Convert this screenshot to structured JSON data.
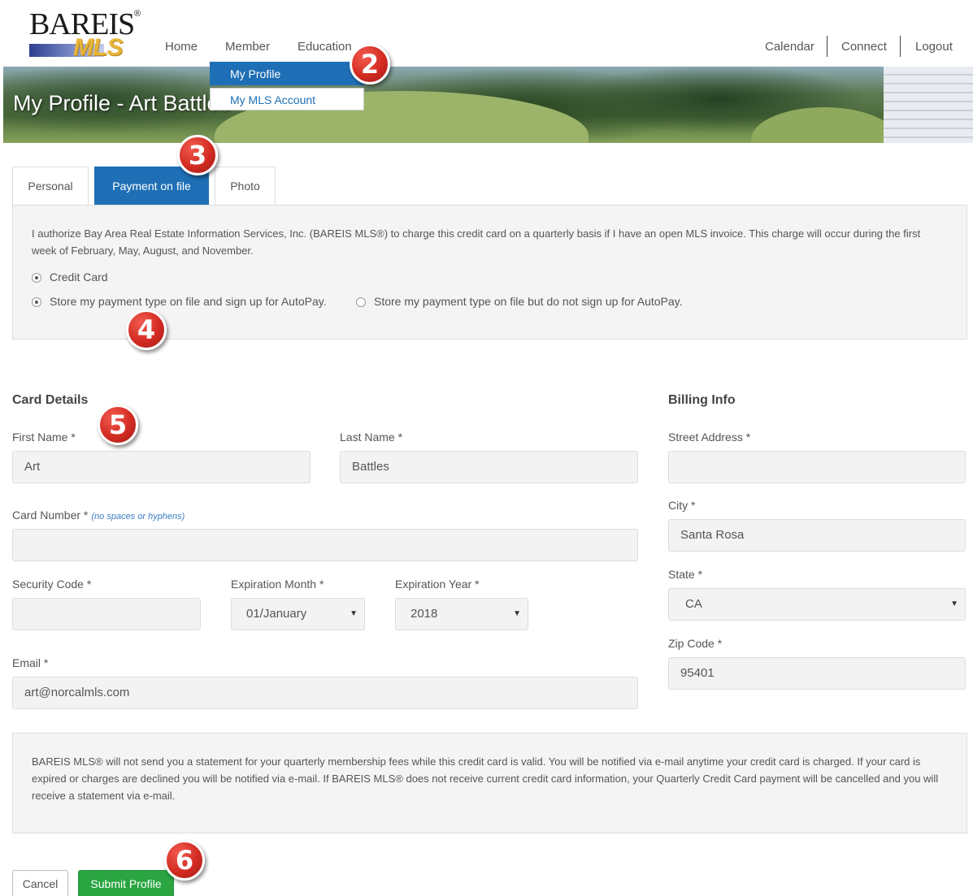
{
  "logo": {
    "text_top": "BAREIS",
    "reg": "®",
    "text_bottom": "MLS"
  },
  "nav": {
    "left": [
      "Home",
      "Member",
      "Education"
    ],
    "right": [
      "Calendar",
      "Connect",
      "Logout"
    ]
  },
  "dropdown": [
    "My Profile",
    "My MLS Account"
  ],
  "hero": {
    "title": "My Profile - Art Battles"
  },
  "badges": [
    "2",
    "3",
    "4",
    "5",
    "6"
  ],
  "tabs": [
    "Personal",
    "Payment on file",
    "Photo"
  ],
  "authorization": {
    "text": "I authorize Bay Area Real Estate Information Services, Inc. (BAREIS MLS®) to charge this credit card on a quarterly basis if I have an open MLS invoice. This charge will occur during the first week of February, May, August, and November.",
    "payment_type": "Credit Card",
    "option_autopay": "Store my payment type on file and sign up for AutoPay.",
    "option_no_autopay": "Store my payment type on file but do not sign up for AutoPay."
  },
  "card_details": {
    "title": "Card Details",
    "first_name_label": "First Name *",
    "first_name_value": "Art",
    "last_name_label": "Last Name *",
    "last_name_value": "Battles",
    "card_number_label": "Card Number *",
    "card_number_hint": "(no spaces or hyphens)",
    "card_number_value": "",
    "security_code_label": "Security Code *",
    "security_code_value": "",
    "exp_month_label": "Expiration Month *",
    "exp_month_value": "01/January",
    "exp_year_label": "Expiration Year *",
    "exp_year_value": "2018",
    "email_label": "Email *",
    "email_value": "art@norcalmls.com"
  },
  "billing_info": {
    "title": "Billing Info",
    "street_label": "Street Address *",
    "street_value": "",
    "city_label": "City *",
    "city_value": "Santa Rosa",
    "state_label": "State *",
    "state_value": "CA",
    "zip_label": "Zip Code *",
    "zip_value": "95401"
  },
  "notice": {
    "text": "BAREIS MLS® will not send you a statement for your quarterly membership fees while this credit card is valid. You will be notified via e-mail anytime your credit card is charged. If your card is expired or charges are declined you will be notified via e-mail. If BAREIS MLS® does not receive current credit card information, your Quarterly Credit Card payment will be cancelled and you will receive a statement via e-mail."
  },
  "buttons": {
    "cancel": "Cancel",
    "submit": "Submit Profile"
  },
  "colors": {
    "primary": "#1e6fb5",
    "submit": "#2aa541",
    "badge": "#d32b22"
  }
}
